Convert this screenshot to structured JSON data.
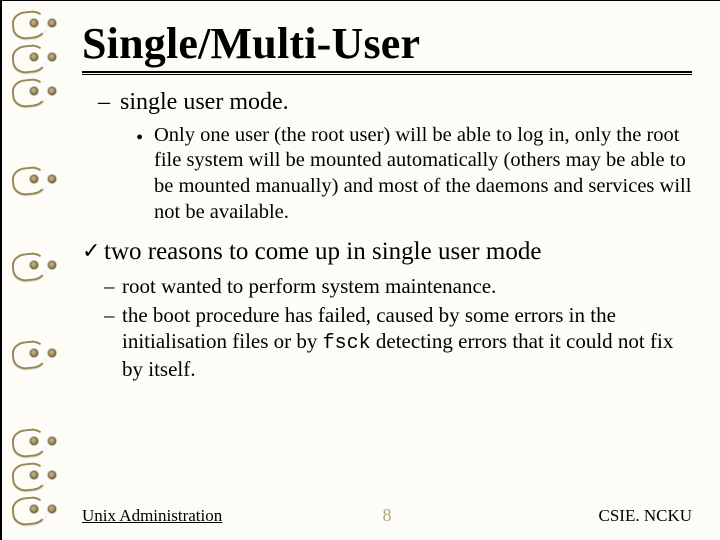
{
  "title": "Single/Multi-User",
  "items": {
    "single_user_mode_label": "single user mode.",
    "single_user_detail": "Only one user (the root user) will be able to log in, only the root file system will be mounted automatically (others may be able to be mounted manually) and most of the daemons and services will not be available.",
    "two_reasons_label": "two reasons to come up in single user mode",
    "reason1": "root wanted to perform system maintenance.",
    "reason2_pre": "the boot procedure has failed, caused by some errors in the initialisation files or by ",
    "reason2_code": "fsck",
    "reason2_post": " detecting errors that it could not fix by itself."
  },
  "bullets": {
    "dash": "–",
    "dot": "•",
    "check": "✓"
  },
  "footer": {
    "left": "Unix Administration",
    "page": "8",
    "right": "CSIE. NCKU"
  }
}
